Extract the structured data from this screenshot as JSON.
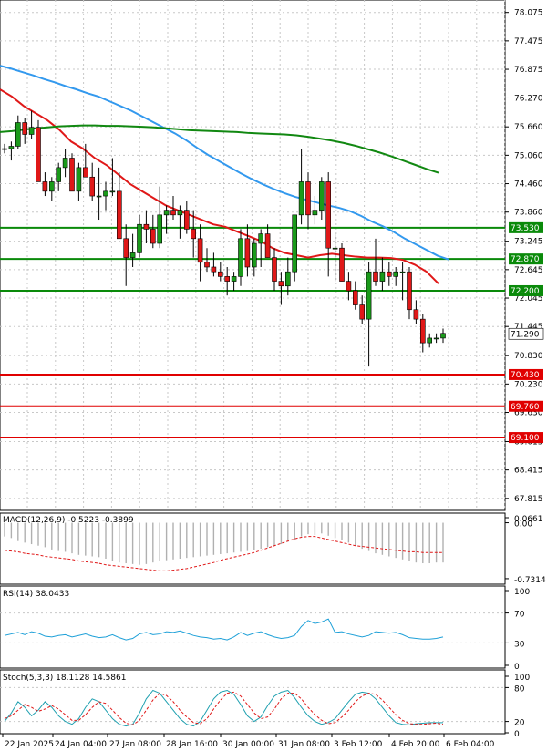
{
  "chart_data": {
    "type": "candlestick",
    "price": {
      "ylim": [
        67.6,
        78.3
      ],
      "yticks": [
        "78.075",
        "77.475",
        "76.875",
        "76.270",
        "75.660",
        "75.060",
        "74.460",
        "73.860",
        "73.245",
        "72.645",
        "72.045",
        "71.445",
        "70.830",
        "70.230",
        "69.630",
        "69.015",
        "68.415",
        "67.815"
      ],
      "current_price": "71.290",
      "levels": [
        {
          "label": "73.530",
          "value": 73.53,
          "color": "#0a8a0a"
        },
        {
          "label": "72.870",
          "value": 72.87,
          "color": "#0a8a0a"
        },
        {
          "label": "72.200",
          "value": 72.2,
          "color": "#0a8a0a"
        },
        {
          "label": "70.430",
          "value": 70.43,
          "color": "#e00000"
        },
        {
          "label": "69.760",
          "value": 69.76,
          "color": "#e00000"
        },
        {
          "label": "69.100",
          "value": 69.1,
          "color": "#e00000"
        }
      ],
      "candles": [
        [
          75.2,
          75.3,
          75.1,
          75.2
        ],
        [
          75.2,
          75.35,
          74.95,
          75.25
        ],
        [
          75.25,
          75.9,
          75.2,
          75.75
        ],
        [
          75.75,
          75.85,
          75.3,
          75.5
        ],
        [
          75.5,
          76.0,
          75.4,
          75.65
        ],
        [
          75.65,
          75.8,
          74.7,
          74.5
        ],
        [
          74.5,
          74.7,
          74.2,
          74.3
        ],
        [
          74.3,
          74.6,
          74.1,
          74.5
        ],
        [
          74.5,
          74.9,
          74.3,
          74.8
        ],
        [
          74.8,
          75.2,
          74.6,
          75.0
        ],
        [
          75.0,
          75.1,
          74.3,
          74.3
        ],
        [
          74.3,
          74.9,
          74.1,
          74.8
        ],
        [
          74.8,
          75.3,
          74.7,
          74.6
        ],
        [
          74.6,
          74.9,
          74.1,
          74.2
        ],
        [
          74.2,
          74.8,
          73.7,
          74.2
        ],
        [
          74.2,
          74.5,
          73.9,
          74.3
        ],
        [
          74.3,
          75.0,
          74.2,
          74.3
        ],
        [
          74.3,
          74.7,
          73.5,
          73.3
        ],
        [
          73.3,
          73.6,
          72.3,
          72.9
        ],
        [
          72.9,
          73.4,
          72.7,
          73.0
        ],
        [
          73.0,
          73.8,
          72.9,
          73.6
        ],
        [
          73.6,
          73.9,
          73.2,
          73.5
        ],
        [
          73.5,
          73.8,
          73.1,
          73.2
        ],
        [
          73.2,
          74.4,
          73.1,
          73.8
        ],
        [
          73.8,
          74.0,
          73.4,
          73.9
        ],
        [
          73.9,
          74.2,
          73.7,
          73.8
        ],
        [
          73.8,
          74.0,
          73.3,
          73.9
        ],
        [
          73.9,
          74.1,
          73.4,
          73.5
        ],
        [
          73.5,
          73.9,
          72.9,
          73.3
        ],
        [
          73.3,
          73.6,
          72.4,
          72.8
        ],
        [
          72.8,
          73.1,
          72.6,
          72.7
        ],
        [
          72.7,
          73.0,
          72.5,
          72.6
        ],
        [
          72.6,
          72.8,
          72.4,
          72.5
        ],
        [
          72.5,
          72.7,
          72.1,
          72.4
        ],
        [
          72.4,
          72.6,
          72.2,
          72.5
        ],
        [
          72.5,
          73.5,
          72.3,
          73.3
        ],
        [
          73.3,
          73.6,
          72.5,
          72.7
        ],
        [
          72.7,
          73.3,
          72.5,
          73.2
        ],
        [
          73.2,
          73.5,
          72.7,
          73.4
        ],
        [
          73.4,
          73.6,
          72.9,
          72.9
        ],
        [
          72.9,
          73.1,
          72.2,
          72.4
        ],
        [
          72.4,
          72.6,
          71.9,
          72.3
        ],
        [
          72.3,
          72.9,
          72.1,
          72.6
        ],
        [
          72.6,
          73.8,
          72.4,
          73.8
        ],
        [
          73.8,
          75.2,
          73.6,
          74.5
        ],
        [
          74.5,
          74.7,
          73.5,
          73.8
        ],
        [
          73.8,
          74.2,
          73.6,
          73.9
        ],
        [
          73.9,
          74.6,
          73.7,
          74.5
        ],
        [
          74.5,
          74.7,
          72.5,
          73.1
        ],
        [
          73.1,
          73.4,
          72.4,
          73.1
        ],
        [
          73.1,
          73.2,
          72.4,
          72.4
        ],
        [
          72.4,
          72.6,
          72.0,
          72.2
        ],
        [
          72.2,
          72.4,
          71.8,
          71.9
        ],
        [
          71.9,
          72.1,
          71.5,
          71.6
        ],
        [
          71.6,
          72.8,
          70.6,
          72.6
        ],
        [
          72.6,
          73.3,
          72.3,
          72.4
        ],
        [
          72.4,
          72.9,
          72.2,
          72.6
        ],
        [
          72.6,
          72.8,
          72.3,
          72.5
        ],
        [
          72.5,
          72.7,
          72.3,
          72.6
        ],
        [
          72.6,
          72.8,
          72.0,
          72.6
        ],
        [
          72.6,
          72.7,
          71.6,
          71.8
        ],
        [
          71.8,
          72.0,
          71.5,
          71.6
        ],
        [
          71.6,
          71.7,
          70.9,
          71.1
        ],
        [
          71.1,
          71.3,
          71.0,
          71.2
        ],
        [
          71.2,
          71.3,
          71.1,
          71.2
        ],
        [
          71.2,
          71.4,
          71.1,
          71.3
        ]
      ],
      "ma_blue": [
        76.95,
        76.89,
        76.82,
        76.75,
        76.67,
        76.6,
        76.52,
        76.45,
        76.37,
        76.3,
        76.2,
        76.1,
        76.0,
        75.88,
        75.76,
        75.64,
        75.52,
        75.38,
        75.22,
        75.07,
        74.94,
        74.81,
        74.68,
        74.56,
        74.45,
        74.35,
        74.26,
        74.18,
        74.12,
        74.06,
        74.0,
        73.95,
        73.88,
        73.78,
        73.66,
        73.56,
        73.44,
        73.3,
        73.18,
        73.06,
        72.94,
        72.86
      ],
      "ma_red": [
        76.45,
        76.3,
        76.1,
        75.95,
        75.8,
        75.6,
        75.35,
        75.2,
        75.0,
        74.85,
        74.65,
        74.45,
        74.3,
        74.15,
        74.0,
        73.9,
        73.8,
        73.7,
        73.6,
        73.55,
        73.45,
        73.35,
        73.25,
        73.1,
        73.0,
        72.95,
        72.9,
        72.95,
        72.98,
        72.95,
        72.92,
        72.9,
        72.9,
        72.89,
        72.85,
        72.75,
        72.6,
        72.35
      ],
      "ma_green": [
        75.55,
        75.57,
        75.6,
        75.63,
        75.65,
        75.67,
        75.68,
        75.69,
        75.69,
        75.68,
        75.68,
        75.67,
        75.66,
        75.65,
        75.63,
        75.61,
        75.59,
        75.58,
        75.57,
        75.56,
        75.55,
        75.53,
        75.52,
        75.51,
        75.5,
        75.48,
        75.45,
        75.41,
        75.37,
        75.32,
        75.26,
        75.19,
        75.12,
        75.04,
        74.95,
        74.86,
        74.77,
        74.69
      ],
      "legend_colors": {
        "blue": "#3399ee",
        "red": "#e01818",
        "green": "#118811"
      }
    },
    "macd": {
      "title": "MACD(12,26,9) -0.5223 -0.3899",
      "yticks": [
        "0.0661",
        "0.00",
        "-0.7314"
      ],
      "ylim": [
        -0.78,
        0.09
      ],
      "hist": [
        -0.18,
        -0.2,
        -0.24,
        -0.26,
        -0.28,
        -0.3,
        -0.32,
        -0.35,
        -0.37,
        -0.38,
        -0.4,
        -0.42,
        -0.43,
        -0.44,
        -0.45,
        -0.47,
        -0.5,
        -0.52,
        -0.53,
        -0.54,
        -0.55,
        -0.54,
        -0.52,
        -0.5,
        -0.49,
        -0.48,
        -0.47,
        -0.46,
        -0.45,
        -0.44,
        -0.43,
        -0.42,
        -0.41,
        -0.4,
        -0.39,
        -0.38,
        -0.37,
        -0.36,
        -0.34,
        -0.32,
        -0.3,
        -0.28,
        -0.25,
        -0.22,
        -0.18,
        -0.15,
        -0.16,
        -0.14,
        -0.17,
        -0.2,
        -0.23,
        -0.26,
        -0.3,
        -0.34,
        -0.37,
        -0.4,
        -0.42,
        -0.44,
        -0.46,
        -0.48,
        -0.5,
        -0.52,
        -0.53,
        -0.53,
        -0.52,
        -0.52
      ],
      "signal": [
        -0.36,
        -0.37,
        -0.38,
        -0.4,
        -0.41,
        -0.42,
        -0.44,
        -0.45,
        -0.46,
        -0.47,
        -0.48,
        -0.5,
        -0.51,
        -0.52,
        -0.53,
        -0.55,
        -0.56,
        -0.57,
        -0.58,
        -0.59,
        -0.6,
        -0.61,
        -0.62,
        -0.63,
        -0.63,
        -0.62,
        -0.61,
        -0.6,
        -0.58,
        -0.56,
        -0.54,
        -0.52,
        -0.49,
        -0.47,
        -0.45,
        -0.43,
        -0.41,
        -0.39,
        -0.36,
        -0.33,
        -0.3,
        -0.27,
        -0.24,
        -0.21,
        -0.19,
        -0.18,
        -0.18,
        -0.2,
        -0.22,
        -0.24,
        -0.26,
        -0.28,
        -0.3,
        -0.31,
        -0.32,
        -0.33,
        -0.34,
        -0.35,
        -0.36,
        -0.37,
        -0.38,
        -0.38,
        -0.39,
        -0.39,
        -0.39,
        -0.39
      ]
    },
    "rsi": {
      "title": "RSI(14) 38.0433",
      "yticks": [
        "100",
        "70",
        "30",
        "0"
      ],
      "ylim": [
        0,
        100
      ],
      "values": [
        40,
        42,
        44,
        41,
        45,
        43,
        39,
        38,
        40,
        41,
        38,
        40,
        42,
        39,
        37,
        38,
        41,
        37,
        34,
        36,
        42,
        44,
        41,
        42,
        45,
        44,
        46,
        43,
        40,
        38,
        37,
        35,
        36,
        34,
        38,
        44,
        40,
        43,
        45,
        41,
        38,
        36,
        37,
        40,
        52,
        60,
        56,
        58,
        62,
        44,
        45,
        42,
        40,
        38,
        40,
        45,
        44,
        43,
        44,
        41,
        37,
        36,
        35,
        35,
        36,
        38
      ]
    },
    "stoch": {
      "title": "Stoch(5,3,3) 18.1128 14.5861",
      "yticks": [
        "100",
        "80",
        "20",
        "0"
      ],
      "ylim": [
        0,
        100
      ],
      "k": [
        20,
        35,
        55,
        45,
        30,
        40,
        55,
        45,
        30,
        20,
        15,
        25,
        45,
        60,
        55,
        40,
        25,
        15,
        12,
        15,
        35,
        60,
        75,
        70,
        55,
        40,
        25,
        15,
        12,
        20,
        40,
        60,
        72,
        75,
        68,
        50,
        30,
        20,
        28,
        48,
        65,
        72,
        75,
        62,
        45,
        30,
        20,
        15,
        18,
        25,
        40,
        55,
        68,
        72,
        70,
        60,
        45,
        30,
        18,
        15,
        14,
        16,
        17,
        18,
        18,
        18
      ],
      "d": [
        25,
        30,
        40,
        50,
        45,
        38,
        42,
        48,
        42,
        32,
        22,
        22,
        32,
        45,
        55,
        52,
        40,
        27,
        17,
        14,
        22,
        40,
        58,
        70,
        66,
        55,
        40,
        28,
        18,
        16,
        25,
        42,
        58,
        70,
        72,
        65,
        50,
        35,
        25,
        28,
        42,
        60,
        70,
        70,
        60,
        45,
        32,
        22,
        16,
        18,
        28,
        40,
        55,
        65,
        70,
        68,
        58,
        45,
        32,
        22,
        16,
        15,
        15,
        16,
        17,
        15
      ]
    },
    "x_labels": [
      "22 Jan 2025",
      "24 Jan 04:00",
      "27 Jan 08:00",
      "28 Jan 16:00",
      "30 Jan 00:00",
      "31 Jan 08:00",
      "3 Feb 12:00",
      "4 Feb 20:00",
      "6 Feb 04:00"
    ]
  }
}
